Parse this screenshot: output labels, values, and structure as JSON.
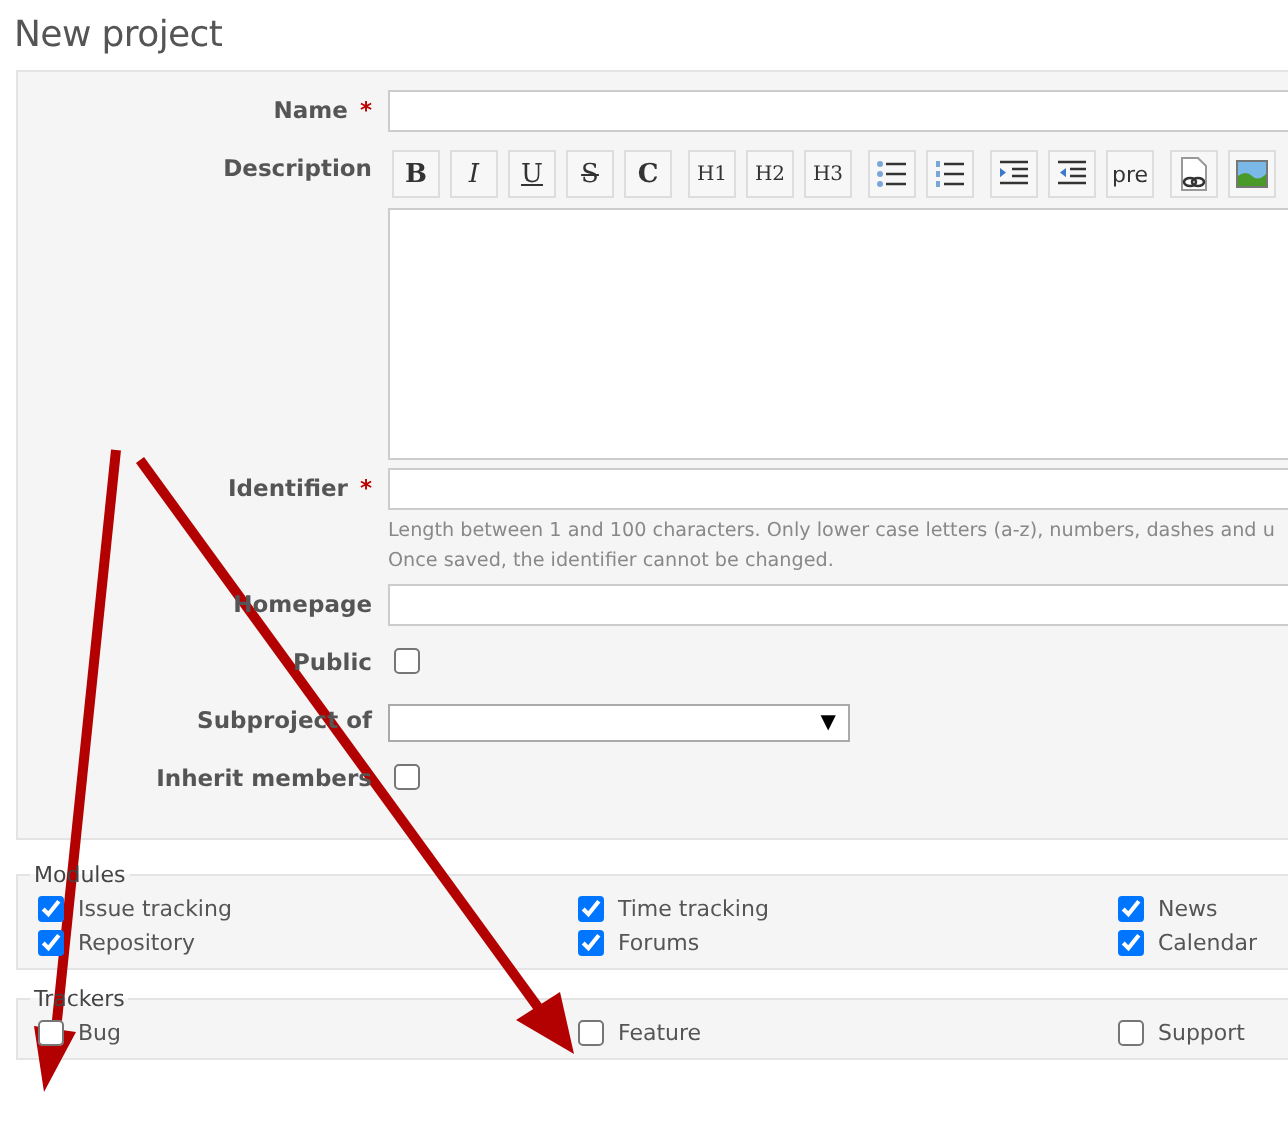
{
  "title": "New project",
  "fields": [
    {
      "label": "Name",
      "mark": "*",
      "kind": "text"
    },
    {
      "label": "Description",
      "kind": "editor"
    },
    {
      "label": "Identifier",
      "mark": "*",
      "kind": "text",
      "help": [
        "Length between 1 and 100 characters. Only lower case letters (a-z), numbers, dashes and u",
        "Once saved, the identifier cannot be changed."
      ]
    },
    {
      "label": "Homepage",
      "kind": "text"
    },
    {
      "label": "Public",
      "kind": "checkbox",
      "checked": false
    },
    {
      "label": "Subproject of",
      "kind": "select",
      "caret": "▼"
    },
    {
      "label": "Inherit members",
      "kind": "checkbox",
      "checked": false
    }
  ],
  "toolbar": [
    [
      {
        "kind": "bold",
        "label": "B"
      },
      {
        "kind": "italic",
        "label": "I"
      },
      {
        "kind": "underline",
        "label": "U"
      },
      {
        "kind": "strike",
        "label": "S"
      },
      {
        "kind": "code",
        "label": "C"
      }
    ],
    [
      {
        "kind": "heading",
        "label": "H1"
      },
      {
        "kind": "heading",
        "label": "H2"
      },
      {
        "kind": "heading",
        "label": "H3"
      }
    ],
    [
      {
        "kind": "bullets"
      },
      {
        "kind": "numbers"
      }
    ],
    [
      {
        "kind": "indent"
      },
      {
        "kind": "outdent"
      },
      {
        "kind": "pre",
        "label": "pre"
      }
    ],
    [
      {
        "kind": "attachment"
      },
      {
        "kind": "image"
      }
    ]
  ],
  "modules": {
    "legend": "Modules",
    "items": [
      {
        "label": "Issue tracking",
        "checked": true
      },
      {
        "label": "Time tracking",
        "checked": true
      },
      {
        "label": "News",
        "checked": true
      },
      {
        "label": "Repository",
        "checked": true
      },
      {
        "label": "Forums",
        "checked": true
      },
      {
        "label": "Calendar",
        "checked": true
      }
    ]
  },
  "trackers": {
    "legend": "Trackers",
    "items": [
      {
        "label": "Bug",
        "checked": false
      },
      {
        "label": "Feature",
        "checked": false
      },
      {
        "label": "Support",
        "checked": false
      }
    ]
  }
}
